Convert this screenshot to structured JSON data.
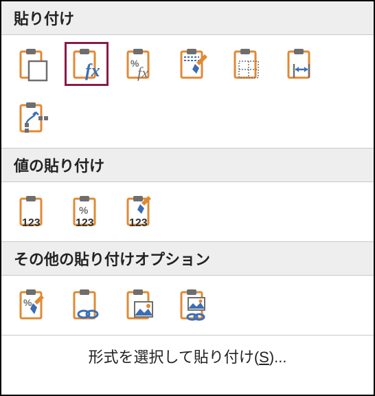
{
  "sections": {
    "paste": {
      "title": "貼り付け"
    },
    "paste_values": {
      "title": "値の貼り付け"
    },
    "other_paste": {
      "title": "その他の貼り付けオプション"
    }
  },
  "footer": {
    "prefix": "形式を選択して貼り付け(",
    "hotkey": "S",
    "suffix": ")..."
  },
  "icons": {
    "orange": "#e08933",
    "blue": "#3d6db3",
    "gray": "#6e6e6e",
    "dark": "#2f2f2f"
  },
  "selected_icon": "paste-formulas"
}
